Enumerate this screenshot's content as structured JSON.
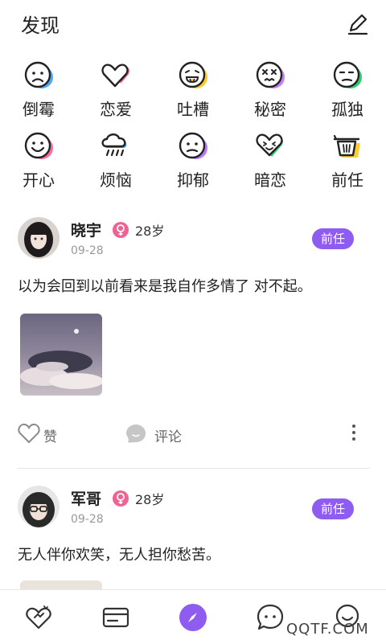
{
  "header": {
    "title": "发现"
  },
  "moods": [
    {
      "label": "倒霉",
      "icon": "sad-face-icon",
      "color": "#4aa8ff"
    },
    {
      "label": "恋爱",
      "icon": "heart-icon",
      "color": "#ff4d8a"
    },
    {
      "label": "吐槽",
      "icon": "tongue-face-icon",
      "color": "#ffc928"
    },
    {
      "label": "秘密",
      "icon": "dizzy-face-icon",
      "color": "#c77dff"
    },
    {
      "label": "孤独",
      "icon": "lonely-face-icon",
      "color": "#2ecc71"
    },
    {
      "label": "开心",
      "icon": "happy-face-icon",
      "color": "#ff6b9d"
    },
    {
      "label": "烦恼",
      "icon": "rain-cloud-icon",
      "color": "#3a9bff"
    },
    {
      "label": "抑郁",
      "icon": "gloomy-face-icon",
      "color": "#b57bff"
    },
    {
      "label": "暗恋",
      "icon": "shy-heart-icon",
      "color": "#2ecc71"
    },
    {
      "label": "前任",
      "icon": "basket-icon",
      "color": "#ffcc33"
    }
  ],
  "posts": [
    {
      "name": "晓宇",
      "age": "28岁",
      "date": "09-28",
      "tag": "前任",
      "content": "以为会回到以前看来是我自作多情了 对不起。",
      "like_label": "赞",
      "comment_label": "评论"
    },
    {
      "name": "军哥",
      "age": "28岁",
      "date": "09-28",
      "tag": "前任",
      "content": "无人伴你欢笑，无人担你愁苦。"
    }
  ],
  "bottom_nav": [
    {
      "icon": "heart-home-icon"
    },
    {
      "icon": "card-icon"
    },
    {
      "icon": "compass-icon",
      "active": true,
      "color": "#8e5cf0"
    },
    {
      "icon": "chat-icon"
    },
    {
      "icon": "profile-face-icon"
    }
  ],
  "watermark": "QQTF.COM"
}
